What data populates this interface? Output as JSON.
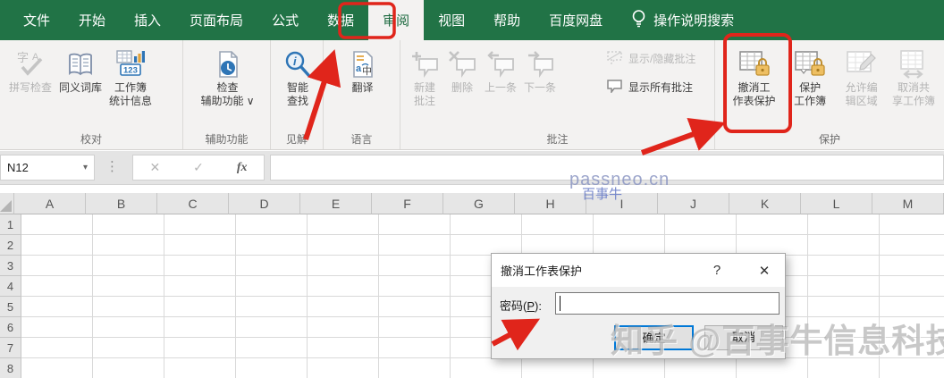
{
  "tabbar": {
    "tabs": [
      "文件",
      "开始",
      "插入",
      "页面布局",
      "公式",
      "数据",
      "审阅",
      "视图",
      "帮助",
      "百度网盘"
    ],
    "active_tab": "审阅",
    "search_hint": "操作说明搜索"
  },
  "ribbon": {
    "proofing": {
      "label": "校对",
      "spell_check": [
        "拼写检查"
      ],
      "thesaurus": [
        "同义词库"
      ],
      "workbook_stats": [
        "工作簿",
        "统计信息"
      ]
    },
    "accessibility": {
      "label": "辅助功能",
      "check": [
        "检查",
        "辅助功能 ∨"
      ]
    },
    "insights": {
      "label": "见解",
      "smart_lookup": [
        "智能",
        "查找"
      ]
    },
    "language": {
      "label": "语言",
      "translate": [
        "翻译"
      ]
    },
    "comments": {
      "label": "批注",
      "new": [
        "新建",
        "批注"
      ],
      "delete": [
        "删除"
      ],
      "previous": [
        "上一条"
      ],
      "next": [
        "下一条"
      ],
      "show_hide": "显示/隐藏批注",
      "show_all": "显示所有批注"
    },
    "protection": {
      "label": "保护",
      "unprotect_sheet": [
        "撤消工",
        "作表保护"
      ],
      "protect_workbook": [
        "保护",
        "工作簿"
      ],
      "allow_edit": [
        "允许编",
        "辑区域"
      ],
      "unshare": [
        "取消共",
        "享工作簿"
      ]
    }
  },
  "formula_bar": {
    "name_box": "N12",
    "dropdown_glyph": "▾",
    "dots_glyph": "⋮",
    "cancel_glyph": "✕",
    "enter_glyph": "✓",
    "fx_glyph": "fx"
  },
  "grid": {
    "columns": [
      "A",
      "B",
      "C",
      "D",
      "E",
      "F",
      "G",
      "H",
      "I",
      "J",
      "K",
      "L",
      "M"
    ],
    "rows": [
      "1",
      "2",
      "3",
      "4",
      "5",
      "6",
      "7",
      "8"
    ]
  },
  "dialog": {
    "title": "撤消工作表保护",
    "help_glyph": "?",
    "close_glyph": "✕",
    "password_prefix": "密码(",
    "password_key": "P",
    "password_suffix": "):",
    "password_value": "",
    "ok": "确定",
    "cancel": "取消"
  },
  "watermarks": {
    "site": "passneo.cn",
    "brand": "百事牛",
    "credit": "知乎 @百事牛信息科技"
  },
  "colors": {
    "excel_green": "#217346",
    "annotation_red": "#e0251b",
    "accent_blue": "#0078d7",
    "lock_gold": "#eebf62"
  }
}
